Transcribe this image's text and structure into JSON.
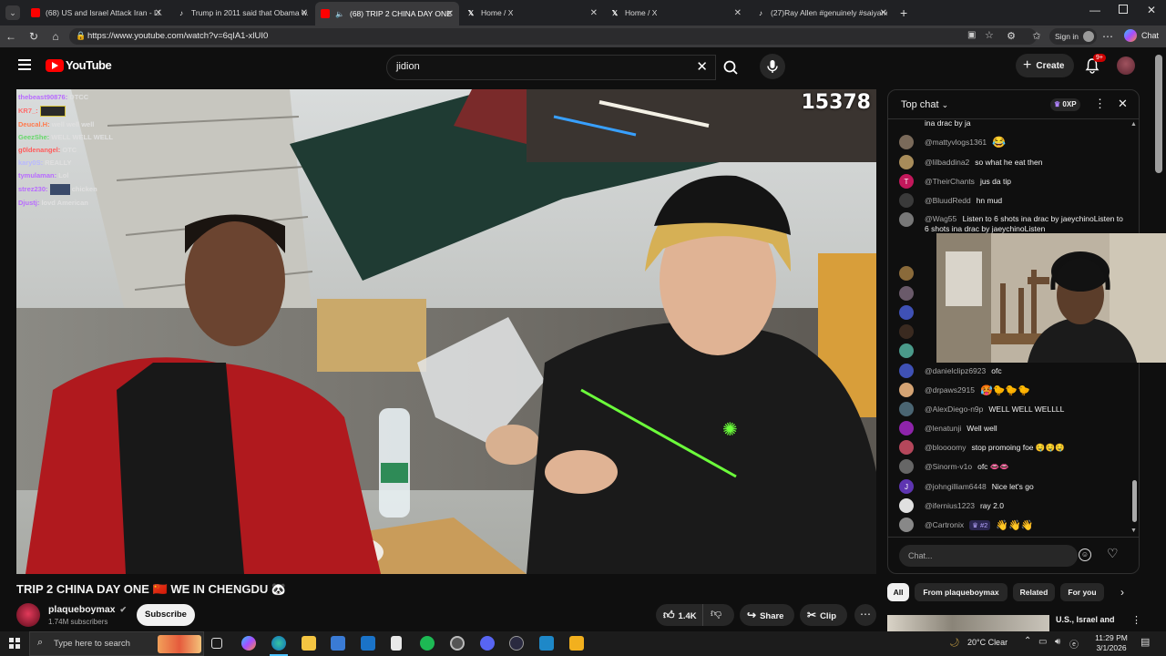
{
  "browser": {
    "tabs": [
      {
        "title": "(68) US and Israel Attack Iran - Li...",
        "icon": "youtube-icon"
      },
      {
        "title": "Trump in 2011 said that Obama w...",
        "icon": "tiktok-icon"
      },
      {
        "title": "(68) TRIP 2 CHINA DAY ONE ...",
        "icon": "youtube-icon",
        "active": true
      },
      {
        "title": "Home / X",
        "icon": "x-icon"
      },
      {
        "title": "Home / X",
        "icon": "x-icon"
      },
      {
        "title": "(27)Ray Allen #genuinely #saiyane...",
        "icon": "tiktok-icon"
      }
    ],
    "url": "https://www.youtube.com/watch?v=6qIA1-xlUI0",
    "sign_in": "Sign in",
    "chat_label": "Chat"
  },
  "youtube": {
    "logo_text": "YouTube",
    "search_value": "jidion",
    "create_label": "Create",
    "notif_count": "9+"
  },
  "video": {
    "viewer_count": "15378",
    "overlay_chat": [
      {
        "user": "thebeast90876:",
        "text": "DTCC",
        "color": "#b86bff"
      },
      {
        "user": "KR7_:",
        "text": "",
        "color": "#ff6b6b"
      },
      {
        "user": "Deucal.H:",
        "text": "well well well",
        "color": "#ff7a4d"
      },
      {
        "user": "GeezShe:",
        "text": "WELL WELL WELL",
        "color": "#67d86b"
      },
      {
        "user": "g0ldenangel:",
        "text": "OTC",
        "color": "#ff5c5c"
      },
      {
        "user": "kary0S:",
        "text": "REALLY",
        "color": "#b8b8ff"
      },
      {
        "user": "tymulaman:",
        "text": "Lol",
        "color": "#b86bff"
      },
      {
        "user": "strez230:",
        "text": "chicken",
        "color": "#b86bff"
      },
      {
        "user": "Djustj:",
        "text": "lovd American",
        "color": "#b86bff"
      }
    ]
  },
  "chat": {
    "header": "Top chat",
    "xp": "0XP",
    "input_placeholder": "Chat...",
    "partial_top": "ina drac by ja",
    "messages": [
      {
        "user": "@mattyvlogs1361",
        "text": "😂",
        "color": "#7a6a5a"
      },
      {
        "user": "@lilbaddina2",
        "text": "so what he eat then",
        "color": "#a88c5a"
      },
      {
        "user": "@TheirChants",
        "text": "jus da tip",
        "color": "#c2185b",
        "initial": "T"
      },
      {
        "user": "@BluudRedd",
        "text": "hn mud",
        "color": "#3a3a3a"
      },
      {
        "user": "@Wag55",
        "text": "Listen to 6 shots ina drac by jaeychinoListen to 6 shots ina drac by jaeychinoListen",
        "color": "#777777"
      },
      {
        "user": "@danielclipz6923",
        "text": "ofc",
        "color": "#3f51b5"
      },
      {
        "user": "@drpaws2915",
        "text": "🥵🐤🐤🐤",
        "color": "#d4a373"
      },
      {
        "user": "@AlexDiego-n9p",
        "text": "WELL WELL WELLLL",
        "color": "#4a6572"
      },
      {
        "user": "@lenatunji",
        "text": "Well well",
        "color": "#8e24aa"
      },
      {
        "user": "@bloooomy",
        "text": "stop promoing foe 🤤🤤🤤",
        "color": "#b5475b"
      },
      {
        "user": "@Sinorm-v1o",
        "text": "ofc 👄👄",
        "color": "#666666"
      },
      {
        "user": "@johngilliam6448",
        "text": "Nice let's go",
        "color": "#5e35b1",
        "initial": "J"
      },
      {
        "user": "@ifernius1223",
        "text": "ray 2.0",
        "color": "#e0e0e0"
      },
      {
        "user": "@Cartronix",
        "text": "👋👋👋",
        "color": "#888888",
        "badge": "#2"
      }
    ]
  },
  "below": {
    "title": "TRIP 2 CHINA DAY ONE 🇨🇳 WE IN CHENGDU 🐼",
    "channel": "plaqueboymax",
    "subscribers": "1.74M subscribers",
    "subscribe": "Subscribe",
    "likes": "1.4K",
    "share": "Share",
    "clip": "Clip",
    "chips": [
      "All",
      "From plaqueboymax",
      "Related",
      "For you"
    ],
    "rec_title": "U.S., Israel and"
  },
  "taskbar": {
    "search_placeholder": "Type here to search",
    "weather": "20°C  Clear",
    "time": "11:29 PM",
    "date": "3/1/2026"
  }
}
